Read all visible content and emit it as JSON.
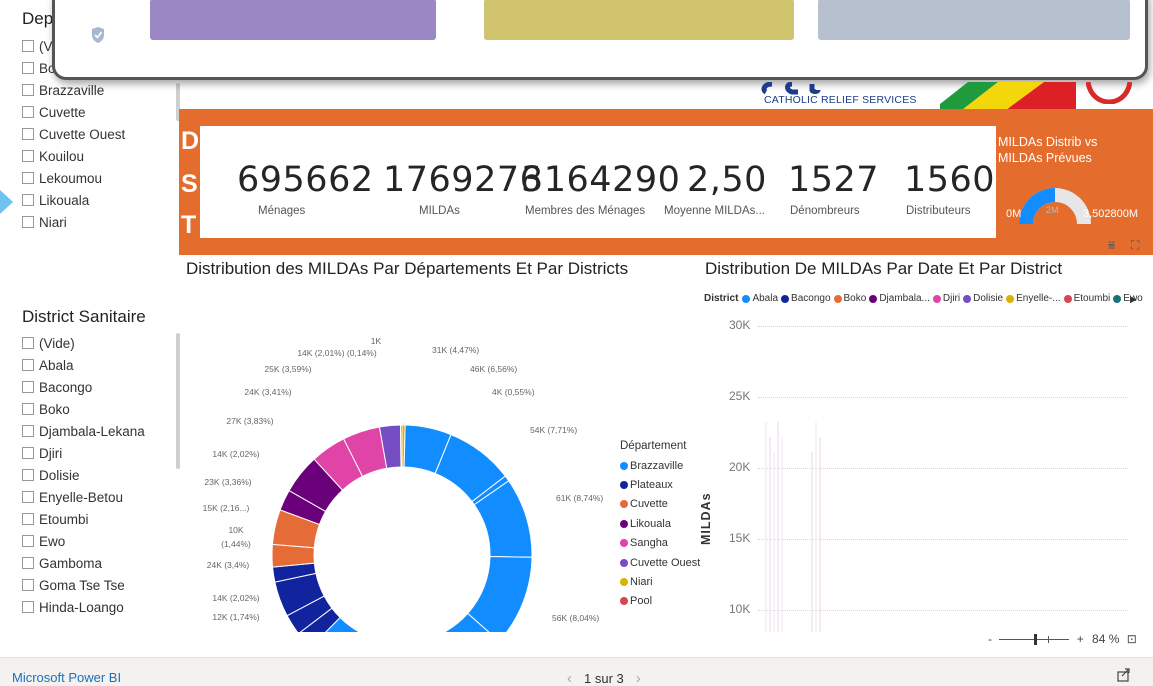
{
  "left_panel": {
    "departement_slicer": {
      "title": "Dep",
      "items": [
        "(V",
        "Bo",
        "Brazzaville",
        "Cuvette",
        "Cuvette Ouest",
        "Kouilou",
        "Lekoumou",
        "Likouala",
        "Niari"
      ]
    },
    "district_slicer": {
      "title": "District Sanitaire",
      "items": [
        "(Vide)",
        "Abala",
        "Bacongo",
        "Boko",
        "Djambala-Lekana",
        "Djiri",
        "Dolisie",
        "Enyelle-Betou",
        "Etoumbi",
        "Ewo",
        "Gamboma",
        "Goma Tse Tse",
        "Hinda-Loango"
      ]
    }
  },
  "popup": {
    "tile_colors": [
      "#9a87c4",
      "#d1c46e",
      "#b6c0cf"
    ]
  },
  "header": {
    "crs_logo_text": "CATHOLIC RELIEF SERVICES"
  },
  "banner": {
    "letters": [
      "D",
      "S",
      "T"
    ],
    "kpis": [
      {
        "value": "695662",
        "label": "Ménages"
      },
      {
        "value": "1769276",
        "label": "MILDAs"
      },
      {
        "value": "3164290",
        "label": "Membres des Ménages"
      },
      {
        "value": "2,50",
        "label": "Moyenne MILDAs..."
      },
      {
        "value": "1527",
        "label": "Dénombreurs"
      },
      {
        "value": "1560",
        "label": "Distributeurs"
      }
    ],
    "gauge": {
      "title_line1": "MILDAs Distrib vs",
      "title_line2": "MILDAs Prévues",
      "min_label": "0M",
      "mid_label": "2M",
      "max_label": "3,502800M",
      "value_fraction": 0.5
    }
  },
  "donut_chart": {
    "title": "Distribution des MILDAs Par Départements Et Par Districts",
    "legend_title": "Département",
    "legend": [
      {
        "name": "Brazzaville",
        "color": "#118dff"
      },
      {
        "name": "Plateaux",
        "color": "#12239e"
      },
      {
        "name": "Cuvette",
        "color": "#e66c37"
      },
      {
        "name": "Likouala",
        "color": "#6b007b"
      },
      {
        "name": "Sangha",
        "color": "#e044a7"
      },
      {
        "name": "Cuvette Ouest",
        "color": "#744ec2"
      },
      {
        "name": "Niari",
        "color": "#d9b300"
      },
      {
        "name": "Pool",
        "color": "#d64550"
      }
    ],
    "labels": [
      "1K",
      "14K (2,01%) (0,14%)",
      "31K (4,47%)",
      "25K (3,59%)",
      "46K (6,56%)",
      "24K (3,41%)",
      "4K (0,55%)",
      "27K (3,83%)",
      "54K (7,71%)",
      "14K (2,02%)",
      "23K (3,36%)",
      "61K (8,74%)",
      "15K (2,16...)",
      "10K",
      "(1,44%)",
      "24K (3,4%)",
      "14K (2,02%)",
      "12K (1,74%)",
      "56K (8,04%)"
    ]
  },
  "line_chart": {
    "title": "Distribution De MILDAs Par Date Et Par District",
    "legend_title": "District",
    "legend": [
      {
        "name": "Abala",
        "color": "#118dff"
      },
      {
        "name": "Bacongo",
        "color": "#12239e"
      },
      {
        "name": "Boko",
        "color": "#e66c37"
      },
      {
        "name": "Djambala...",
        "color": "#6b007b"
      },
      {
        "name": "Djiri",
        "color": "#e044a7"
      },
      {
        "name": "Dolisie",
        "color": "#744ec2"
      },
      {
        "name": "Enyelle-...",
        "color": "#d9b300"
      },
      {
        "name": "Etoumbi",
        "color": "#d64550"
      },
      {
        "name": "Ewo",
        "color": "#197278"
      }
    ],
    "y_label": "MILDAs",
    "y_ticks": [
      "30K",
      "25K",
      "20K",
      "15K",
      "10K"
    ]
  },
  "chart_data": [
    {
      "type": "pie",
      "title": "Distribution des MILDAs Par Départements Et Par Districts",
      "slices": [
        {
          "label": "1K",
          "value": 1000
        },
        {
          "label": "31K (4,47%)",
          "value": 31000
        },
        {
          "label": "46K (6,56%)",
          "value": 46000
        },
        {
          "label": "4K (0,55%)",
          "value": 4000
        },
        {
          "label": "54K (7,71%)",
          "value": 54000
        },
        {
          "label": "61K (8,74%)",
          "value": 61000
        },
        {
          "label": "56K (8,04%)",
          "value": 56000
        },
        {
          "label": "12K (1,74%)",
          "value": 12000
        },
        {
          "label": "14K (2,02%)",
          "value": 14000
        },
        {
          "label": "24K (3,4%)",
          "value": 24000
        },
        {
          "label": "10K (1,44%)",
          "value": 10000
        },
        {
          "label": "15K (2,16...)",
          "value": 15000
        },
        {
          "label": "23K (3,36%)",
          "value": 23000
        },
        {
          "label": "14K (2,02%)",
          "value": 14000
        },
        {
          "label": "27K (3,83%)",
          "value": 27000
        },
        {
          "label": "24K (3,41%)",
          "value": 24000
        },
        {
          "label": "25K (3,59%)",
          "value": 25000
        },
        {
          "label": "14K (2,01%)",
          "value": 14000
        },
        {
          "label": "(0,14%)",
          "value": 1000
        }
      ]
    },
    {
      "type": "line",
      "title": "Distribution De MILDAs Par Date Et Par District",
      "ylabel": "MILDAs",
      "yticks": [
        "30K",
        "25K",
        "20K",
        "15K",
        "10K"
      ]
    }
  ],
  "zoom": {
    "minus": "-",
    "plus": "+",
    "level": "84 %"
  },
  "statusbar": {
    "brand": "Microsoft Power BI",
    "page_indicator": "1 sur 3",
    "prev": "‹",
    "next": "›"
  }
}
